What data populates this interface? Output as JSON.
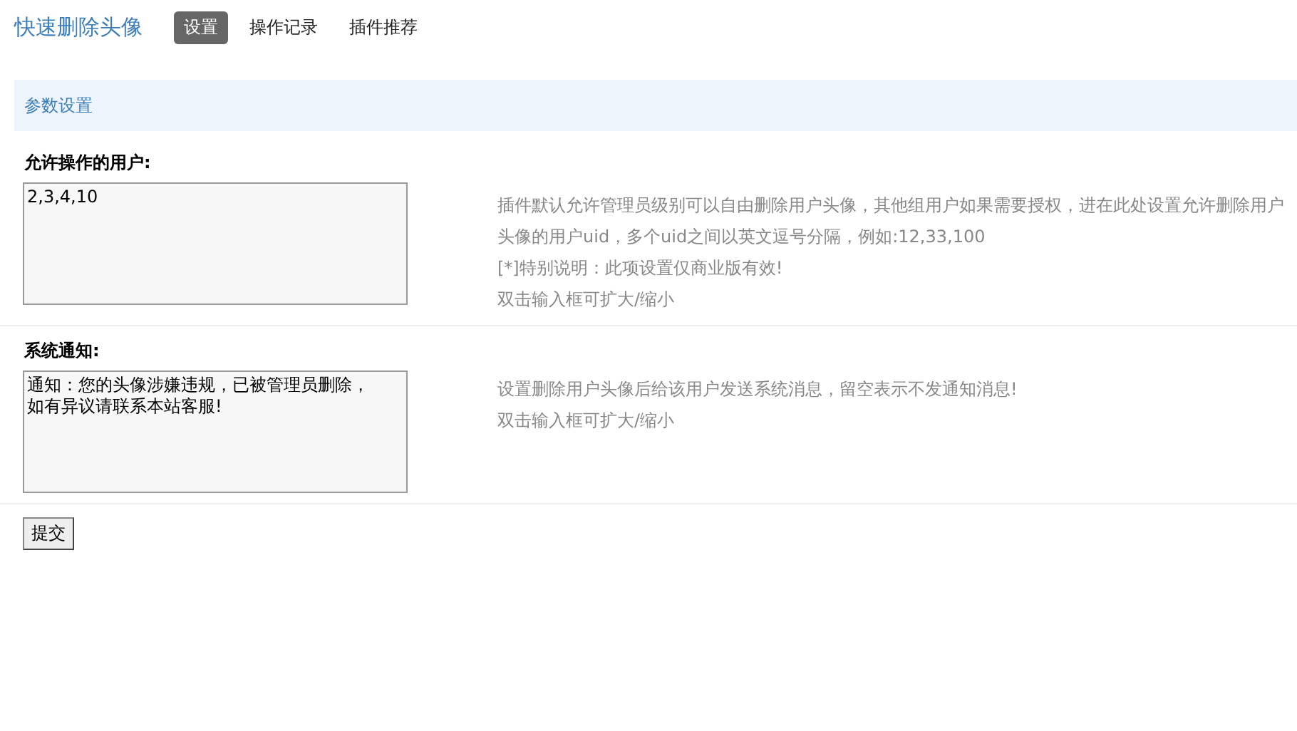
{
  "header": {
    "title": "快速删除头像",
    "tabs": [
      {
        "label": "设置",
        "selected": true
      },
      {
        "label": "操作记录",
        "selected": false
      },
      {
        "label": "插件推荐",
        "selected": false
      }
    ]
  },
  "section": {
    "title": "参数设置"
  },
  "fields": [
    {
      "label": "允许操作的用户:",
      "value": "2,3,4,10",
      "hints": [
        "插件默认允许管理员级别可以自由删除用户头像，其他组用户如果需要授权，进在此处设置允许删除用户头像的用户uid，多个uid之间以英文逗号分隔，例如:12,33,100",
        "[*]特别说明：此项设置仅商业版有效!",
        "双击输入框可扩大/缩小"
      ]
    },
    {
      "label": "系统通知:",
      "value": "通知：您的头像涉嫌违规，已被管理员删除，如有异议请联系本站客服!",
      "hints": [
        "设置删除用户头像后给该用户发送系统消息，留空表示不发通知消息!",
        "双击输入框可扩大/缩小"
      ]
    }
  ],
  "submit": "提交"
}
